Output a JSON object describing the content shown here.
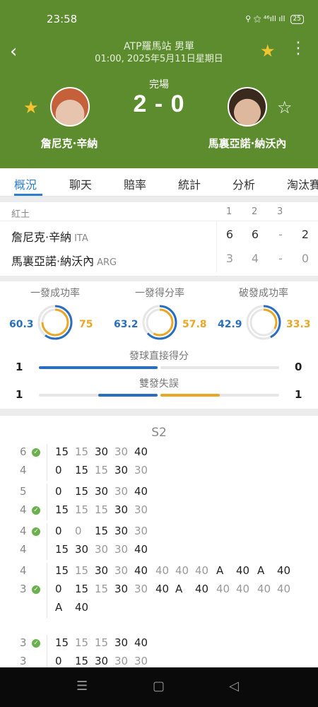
{
  "status_bar": {
    "time": "23:58",
    "icons": "⚲ ⚝ ⁴⁶ıll ıll",
    "battery": "25"
  },
  "header": {
    "title": "ATP羅馬站 男單",
    "datetime": "01:00, 2025年5月11日星期日",
    "status": "完場",
    "score": "2 - 0",
    "player1": "詹尼克·辛納",
    "player2": "馬裏亞諾·納沃內",
    "colors": {
      "background": "#5c8c2e",
      "star_active": "#f4c430"
    }
  },
  "tabs": [
    "概況",
    "聊天",
    "賠率",
    "統計",
    "分析",
    "淘汰賽"
  ],
  "active_tab": 0,
  "sets_table": {
    "surface": "紅土",
    "set_headers": [
      "1",
      "2",
      "3"
    ],
    "rows": [
      {
        "name": "詹尼克·辛納",
        "nat": "ITA",
        "s1": "6",
        "s2": "6",
        "s3": "-",
        "total": "2"
      },
      {
        "name": "馬裏亞諾·納沃內",
        "nat": "ARG",
        "s1": "3",
        "s2": "4",
        "s3": "-",
        "total": "0"
      }
    ]
  },
  "stats": {
    "rings": [
      {
        "title": "一發成功率",
        "left": "60.3",
        "right": "75"
      },
      {
        "title": "一發得分率",
        "left": "63.2",
        "right": "57.8"
      },
      {
        "title": "破發成功率",
        "left": "42.9",
        "right": "33.3"
      }
    ],
    "bars": [
      {
        "title": "發球直接得分",
        "left": "1",
        "right": "0",
        "left_frac": 1.0,
        "right_frac": 0.0
      },
      {
        "title": "雙發失誤",
        "left": "1",
        "right": "1",
        "left_frac": 0.5,
        "right_frac": 0.5
      }
    ],
    "colors": {
      "player1": "#2a6fbf",
      "player2": "#e8a825"
    }
  },
  "pbp": {
    "set_label": "S2",
    "games": [
      {
        "score_top": "6",
        "score_bot": "4",
        "winner": "top",
        "top": [
          "15",
          "15",
          "30",
          "30",
          "40"
        ],
        "bot": [
          "0",
          "15",
          "15",
          "30",
          "30"
        ]
      },
      {
        "score_top": "5",
        "score_bot": "4",
        "winner": "bot",
        "top": [
          "0",
          "15",
          "30",
          "30",
          "40"
        ],
        "bot": [
          "15",
          "15",
          "15",
          "30",
          "30"
        ]
      },
      {
        "score_top": "4",
        "score_bot": "4",
        "winner": "top",
        "top": [
          "0",
          "0",
          "15",
          "30",
          "30"
        ],
        "bot": [
          "15",
          "30",
          "30",
          "30",
          "40"
        ]
      },
      {
        "score_top": "4",
        "score_bot": "3",
        "winner": "bot",
        "top": [
          "15",
          "15",
          "30",
          "30",
          "40",
          "40",
          "40",
          "40",
          "A",
          "40",
          "A",
          "40"
        ],
        "bot": [
          "0",
          "15",
          "15",
          "30",
          "30",
          "40",
          "A",
          "40",
          "40",
          "40",
          "40",
          "40",
          "A",
          "40"
        ]
      },
      {
        "score_top": "3",
        "score_bot": "3",
        "winner": "top",
        "top": [
          "15",
          "15",
          "15",
          "30",
          "40"
        ],
        "bot": [
          "0",
          "15",
          "30",
          "30",
          "30"
        ]
      }
    ]
  }
}
